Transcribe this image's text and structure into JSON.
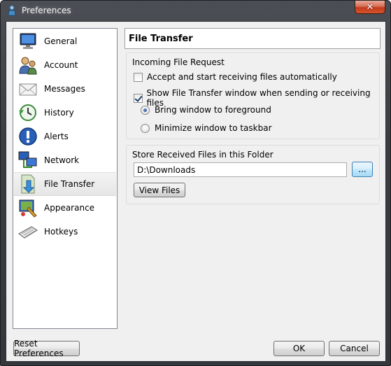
{
  "window": {
    "title": "Preferences",
    "close_label": "✕"
  },
  "sidebar": {
    "items": [
      {
        "label": "General",
        "icon": "monitor-icon"
      },
      {
        "label": "Account",
        "icon": "users-icon"
      },
      {
        "label": "Messages",
        "icon": "envelope-icon"
      },
      {
        "label": "History",
        "icon": "clock-icon"
      },
      {
        "label": "Alerts",
        "icon": "alert-icon"
      },
      {
        "label": "Network",
        "icon": "network-icon"
      },
      {
        "label": "File Transfer",
        "icon": "file-download-icon",
        "selected": true
      },
      {
        "label": "Appearance",
        "icon": "appearance-icon"
      },
      {
        "label": "Hotkeys",
        "icon": "keyboard-icon"
      }
    ]
  },
  "main": {
    "title": "File Transfer",
    "incoming": {
      "title": "Incoming File Request",
      "auto_accept_label": "Accept and start receiving files automatically",
      "auto_accept_checked": false,
      "show_window_label": "Show File Transfer window when sending or receiving files",
      "show_window_checked": true,
      "radio_foreground_label": "Bring window to foreground",
      "radio_minimize_label": "Minimize window to taskbar",
      "selected_radio": "foreground"
    },
    "store": {
      "title": "Store Received Files in this Folder",
      "path_value": "D:\\Downloads",
      "browse_label": "...",
      "view_files_label": "View Files"
    }
  },
  "footer": {
    "reset_label": "Reset Preferences",
    "ok_label": "OK",
    "cancel_label": "Cancel"
  },
  "colors": {
    "frame": "#3a3d42",
    "client_bg": "#f0f0f0",
    "selection_bg": "#e6e6e6",
    "close_red": "#c23b1d",
    "focus_blue": "#3c7fb1"
  }
}
